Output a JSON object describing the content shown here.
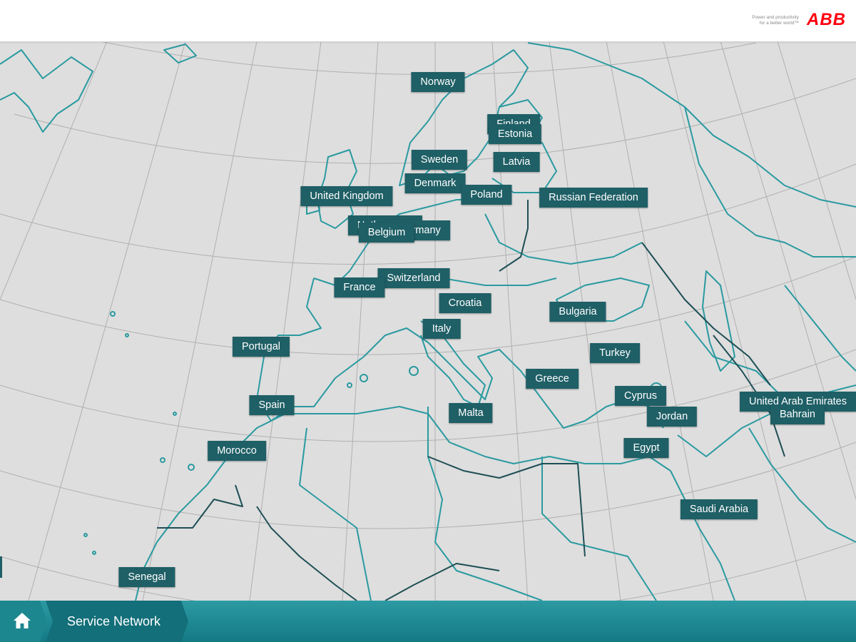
{
  "header": {
    "tagline_line1": "Power and productivity",
    "tagline_line2": "for a better world™",
    "logo_text": "ABB"
  },
  "map": {
    "background_color": "#dedede",
    "grid_color": "#b0b0b0",
    "border_color": "#2a9aa0",
    "dark_border_color": "#1e4f55",
    "countries": {
      "norway": "Norway",
      "finland": "Finland",
      "estonia": "Estonia",
      "sweden": "Sweden",
      "latvia": "Latvia",
      "denmark": "Denmark",
      "united_kingdom": "United Kingdom",
      "poland": "Poland",
      "russian_federation": "Russian Federation",
      "netherlands": "Netherlands",
      "germany": "Germany",
      "belgium": "Belgium",
      "switzerland": "Switzerland",
      "france": "France",
      "croatia": "Croatia",
      "bulgaria": "Bulgaria",
      "italy": "Italy",
      "portugal": "Portugal",
      "turkey": "Turkey",
      "greece": "Greece",
      "cyprus": "Cyprus",
      "united_arab_emirates": "United Arab Emirates",
      "spain": "Spain",
      "malta": "Malta",
      "jordan": "Jordan",
      "bahrain": "Bahrain",
      "morocco": "Morocco",
      "egypt": "Egypt",
      "saudi_arabia": "Saudi Arabia",
      "senegal": "Senegal"
    }
  },
  "footer": {
    "home_icon": "home-icon",
    "breadcrumb_label": "Service Network"
  },
  "colors": {
    "label_bg": "#1f5f66",
    "footer_teal": "#2c9aa3",
    "brand_red": "#ff000f"
  }
}
